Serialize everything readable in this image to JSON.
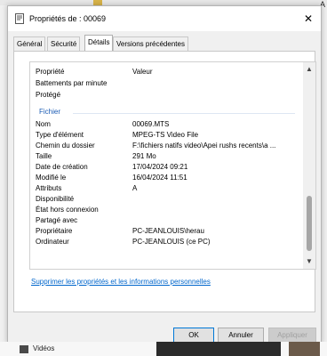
{
  "window": {
    "title": "Propriétés de : 00069",
    "close_glyph": "✕"
  },
  "background": {
    "top_letter": "A",
    "bottom_label": "Vidéos"
  },
  "tabs": [
    "Général",
    "Sécurité",
    "Détails",
    "Versions précédentes"
  ],
  "active_tab": "Détails",
  "list": {
    "header": {
      "k": "Propriété",
      "v": "Valeur"
    },
    "pre_rows": [
      {
        "k": "Battements par minute",
        "v": ""
      },
      {
        "k": "Protégé",
        "v": ""
      }
    ],
    "section_label": "Fichier",
    "rows": [
      {
        "k": "Nom",
        "v": "00069.MTS"
      },
      {
        "k": "Type d'élément",
        "v": "MPEG-TS Video File"
      },
      {
        "k": "Chemin du dossier",
        "v": "F:\\fichiers natifs video\\Apei   rushs recents\\a ..."
      },
      {
        "k": "Taille",
        "v": "291 Mo"
      },
      {
        "k": "Date de création",
        "v": "17/04/2024 09:21"
      },
      {
        "k": "Modifié le",
        "v": "16/04/2024 11:51"
      },
      {
        "k": "Attributs",
        "v": "A"
      },
      {
        "k": "Disponibilité",
        "v": ""
      },
      {
        "k": "État hors connexion",
        "v": ""
      },
      {
        "k": "Partagé avec",
        "v": ""
      },
      {
        "k": "Propriétaire",
        "v": "PC-JEANLOUIS\\herau"
      },
      {
        "k": "Ordinateur",
        "v": "PC-JEANLOUIS (ce PC)"
      }
    ]
  },
  "link_text": "Supprimer les propriétés et les informations personnelles",
  "buttons": {
    "ok": "OK",
    "cancel": "Annuler",
    "apply": "Appliquer"
  },
  "icons": {
    "title": "document-properties-icon",
    "close": "close-icon",
    "scroll_up": "chevron-up-icon",
    "scroll_down": "chevron-down-icon",
    "videos": "video-folder-icon"
  },
  "colors": {
    "link": "#0066cc",
    "section": "#1a5bb4",
    "ok_border": "#0078d7"
  }
}
